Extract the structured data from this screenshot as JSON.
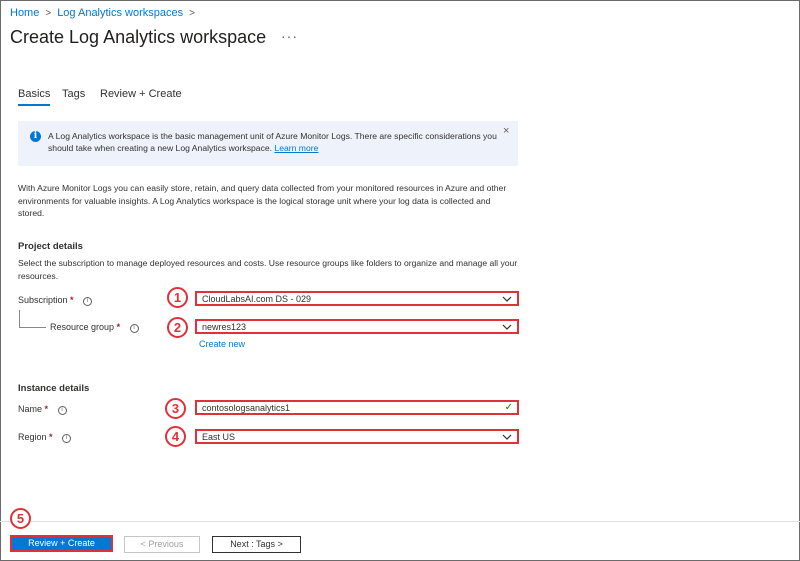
{
  "breadcrumb": {
    "items": [
      "Home",
      "Log Analytics workspaces"
    ],
    "separator": ">"
  },
  "page": {
    "title": "Create Log Analytics workspace",
    "more": "···"
  },
  "tabs": [
    {
      "label": "Basics",
      "active": true
    },
    {
      "label": "Tags",
      "active": false
    },
    {
      "label": "Review + Create",
      "active": false
    }
  ],
  "info_banner": {
    "text": "A Log Analytics workspace is the basic management unit of Azure Monitor Logs. There are specific considerations you should take when creating a new Log Analytics workspace.",
    "link": "Learn more",
    "close": "×"
  },
  "intro": "With Azure Monitor Logs you can easily store, retain, and query data collected from your monitored resources in Azure and other environments for valuable insights. A Log Analytics workspace is the logical storage unit where your log data is collected and stored.",
  "project_details": {
    "heading": "Project details",
    "description": "Select the subscription to manage deployed resources and costs. Use resource groups like folders to organize and manage all your resources.",
    "subscription": {
      "label": "Subscription",
      "value": "CloudLabsAI.com DS - 029",
      "callout": "1"
    },
    "resource_group": {
      "label": "Resource group",
      "value": "newres123",
      "callout": "2",
      "create_new": "Create new"
    }
  },
  "instance_details": {
    "heading": "Instance details",
    "name": {
      "label": "Name",
      "value": "contosologsanalytics1",
      "callout": "3"
    },
    "region": {
      "label": "Region",
      "value": "East US",
      "callout": "4"
    }
  },
  "footer": {
    "callout": "5",
    "review_create": "Review + Create",
    "previous": "< Previous",
    "next": "Next : Tags >"
  },
  "required_marker": "*",
  "info_glyph": "i",
  "colors": {
    "accent": "#0078d4",
    "highlight": "#e0303a",
    "info_bg": "#eef3fb",
    "valid": "#107c10"
  }
}
